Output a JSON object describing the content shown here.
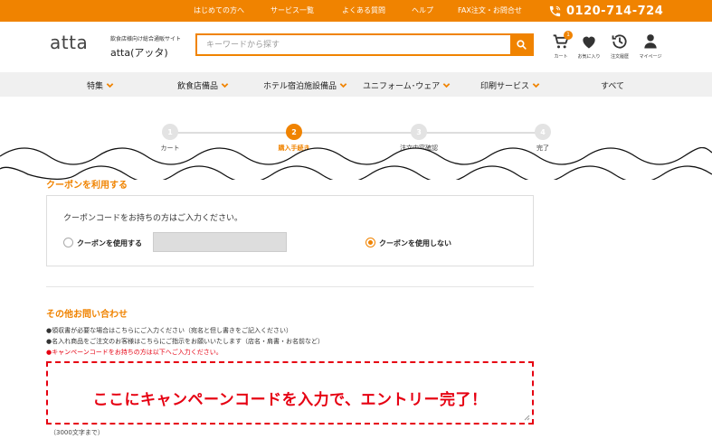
{
  "topbar": {
    "links": [
      "はじめての方へ",
      "サービス一覧",
      "よくある質問",
      "ヘルプ",
      "FAX注文・お問合せ"
    ],
    "phone": "0120-714-724"
  },
  "header": {
    "logo": "atta",
    "tagline": "飲食店様向け総合通販サイト",
    "site_name": "atta(アッタ)",
    "search_placeholder": "キーワードから探す",
    "cart_count": "1",
    "icons": [
      {
        "name": "cart-icon",
        "label": "カート"
      },
      {
        "name": "heart-icon",
        "label": "お気に入り"
      },
      {
        "name": "history-icon",
        "label": "注文履歴"
      },
      {
        "name": "user-icon",
        "label": "マイページ"
      }
    ]
  },
  "nav": {
    "items": [
      "特集",
      "飲食店備品",
      "ホテル宿泊施設備品",
      "ユニフォーム･ウェア",
      "印刷サービス",
      "すべて"
    ]
  },
  "steps": [
    {
      "number": "1",
      "label": "カート",
      "active": false
    },
    {
      "number": "2",
      "label": "購入手続き",
      "active": true
    },
    {
      "number": "3",
      "label": "注文内容確認",
      "active": false
    },
    {
      "number": "4",
      "label": "完了",
      "active": false
    }
  ],
  "coupon": {
    "title": "クーポンを利用する",
    "intro": "クーポンコードをお持ちの方はご入力ください。",
    "use_label": "クーポンを使用する",
    "nouse_label": "クーポンを使用しない",
    "selected": "nouse"
  },
  "inquiry": {
    "title": "その他お問い合わせ",
    "notes": [
      "●領収書が必要な場合はこちらにご入力ください（宛名と但し書きをご記入ください）",
      "●名入れ商品をご注文のお客様はこちらにご指示をお願いいたします（店名・肩書・お名前など）"
    ],
    "red_note": "●キャンペーンコードをお持ちの方は以下へご入力ください。",
    "campaign_text": "ここにキャンペーンコードを入力で、エントリー完了！",
    "max_chars": "（3000文字まで）"
  },
  "colors": {
    "brand": "#f08300",
    "alert": "#e60012"
  }
}
